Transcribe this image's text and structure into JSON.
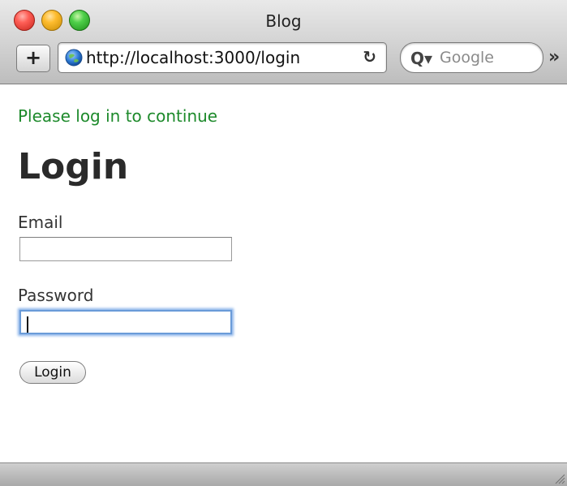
{
  "window": {
    "title": "Blog"
  },
  "toolbar": {
    "new_tab_label": "+",
    "url": "http://localhost:3000/login",
    "reload_glyph": "↻",
    "search_placeholder": "Google",
    "search_glyph": "Q▾",
    "overflow_glyph": "»"
  },
  "page": {
    "flash_message": "Please log in to continue",
    "heading": "Login",
    "email_label": "Email",
    "email_value": "",
    "password_label": "Password",
    "password_value": "",
    "submit_label": "Login"
  },
  "icons": {
    "close": "traffic-close-icon",
    "minimize": "traffic-minimize-icon",
    "maximize": "traffic-maximize-icon",
    "globe": "globe-icon",
    "reload": "reload-icon",
    "search": "search-icon",
    "overflow": "overflow-chevron-icon",
    "resize": "resize-grip-icon"
  },
  "colors": {
    "flash_green": "#1d8a2b",
    "focus_ring": "#6a9bd8"
  }
}
